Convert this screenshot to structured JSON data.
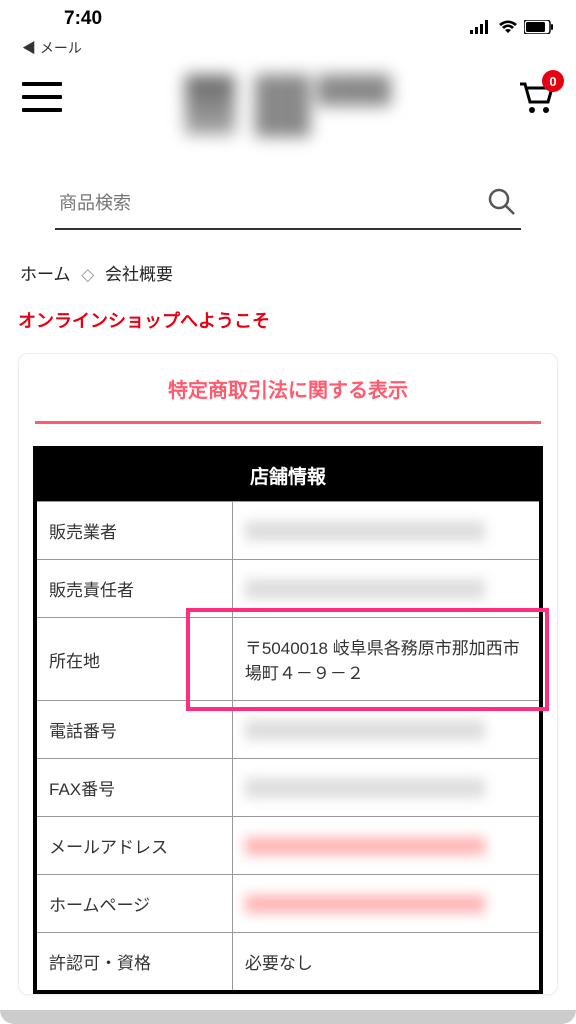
{
  "status": {
    "time": "7:40",
    "back_label": "◀ メール"
  },
  "header": {
    "cart_count": "0"
  },
  "search": {
    "placeholder": "商品検索"
  },
  "breadcrumb": {
    "home": "ホーム",
    "separator": "◇",
    "current": "会社概要"
  },
  "welcome": "オンラインショップへようこそ",
  "card": {
    "title": "特定商取引法に関する表示"
  },
  "table": {
    "header": "店舗情報",
    "rows": [
      {
        "label": "販売業者",
        "value": "",
        "blur": "gray"
      },
      {
        "label": "販売責任者",
        "value": "",
        "blur": "gray"
      },
      {
        "label": "所在地",
        "value": "〒5040018 岐阜県各務原市那加西市場町４－９－２",
        "blur": "none",
        "highlight": true
      },
      {
        "label": "電話番号",
        "value": "",
        "blur": "gray"
      },
      {
        "label": "FAX番号",
        "value": "",
        "blur": "gray"
      },
      {
        "label": "メールアドレス",
        "value": "",
        "blur": "red"
      },
      {
        "label": "ホームページ",
        "value": "",
        "blur": "red"
      },
      {
        "label": "許認可・資格",
        "value": "必要なし",
        "blur": "none"
      }
    ]
  }
}
